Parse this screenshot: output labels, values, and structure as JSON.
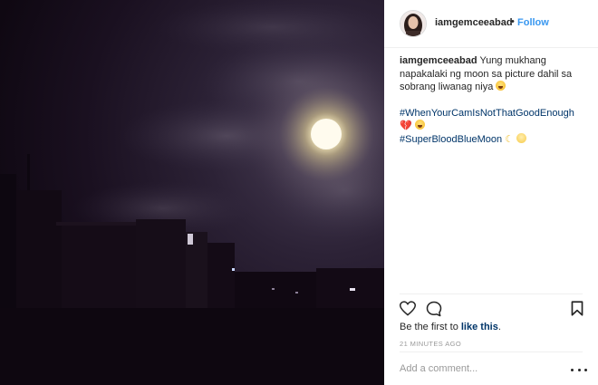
{
  "post": {
    "username": "iamgemceeabad",
    "header_separator": "•",
    "follow_label": "Follow"
  },
  "caption": {
    "username": "iamgemceeabad",
    "text": "Yung mukhang napakalaki ng moon sa picture dahil sa sobrang liwanag niya",
    "hashtag_1": "#WhenYourCamIsNotThatGoodEnough",
    "hashtag_2": "#SuperBloodBlueMoon",
    "emojis": [
      "laughing-tears-emoji",
      "broken-heart-emoji",
      "laughing-tears-emoji",
      "crescent-moon-emoji",
      "full-moon-face-emoji"
    ]
  },
  "likes": {
    "prefix": "Be the first to",
    "link": "like this",
    "suffix": "."
  },
  "timestamp": "21 MINUTES AGO",
  "comment": {
    "placeholder": "Add a comment..."
  },
  "icons": {
    "like": "heart-outline-icon",
    "comment": "comment-bubble-icon",
    "save": "bookmark-icon",
    "more": "more-options-icon"
  },
  "colors": {
    "follow": "#3897f0",
    "hashtag": "#003569",
    "muted": "#999999",
    "broken_heart": "#d1253a"
  }
}
